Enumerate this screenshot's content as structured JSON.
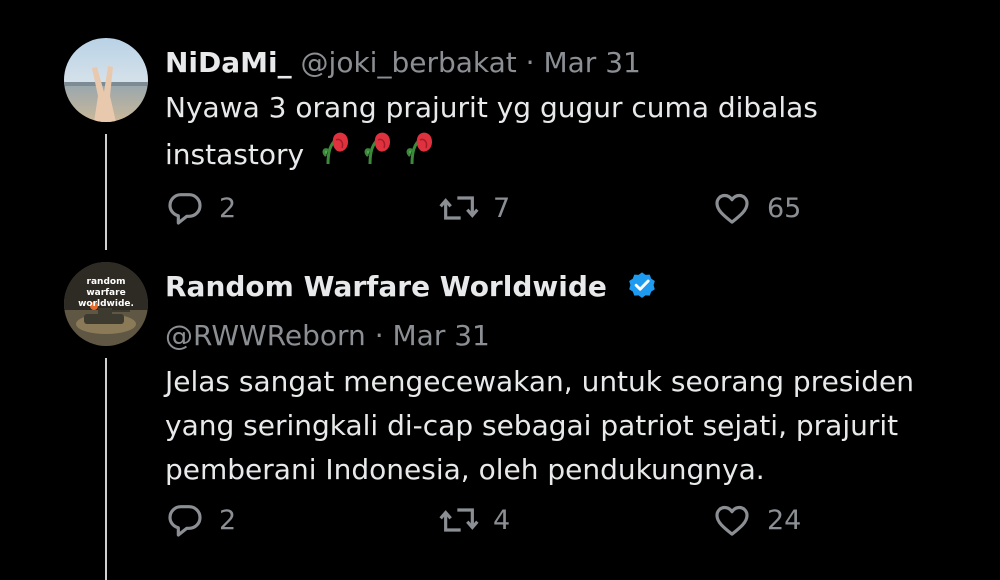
{
  "tweets": [
    {
      "display_name": "NiDaMi_",
      "handle": "@joki_berbakat",
      "separator": "·",
      "date": "Mar 31",
      "text_lines": [
        "Nyawa 3 orang prajurit yg gugur cuma dibalas",
        "instastory"
      ],
      "emoji": [
        "wilted-flower",
        "wilted-flower",
        "wilted-flower"
      ],
      "replies": "2",
      "reposts": "7",
      "likes": "65",
      "verified": false
    },
    {
      "display_name": "Random Warfare Worldwide",
      "handle": "@RWWReborn",
      "separator": "·",
      "date": "Mar 31",
      "avatar_text": [
        "random",
        "warfare",
        "worldwide."
      ],
      "text_lines": [
        "Jelas sangat mengecewakan, untuk seorang presiden",
        "yang seringkali di-cap sebagai patriot sejati, prajurit",
        "pemberani Indonesia, oleh pendukungnya."
      ],
      "replies": "2",
      "reposts": "4",
      "likes": "24",
      "verified": true
    }
  ],
  "colors": {
    "background": "#000000",
    "text": "#e7e9ea",
    "muted": "#8b8f94",
    "verified_badge": "#1d9bf0",
    "thread_line": "#d0d0d0"
  }
}
